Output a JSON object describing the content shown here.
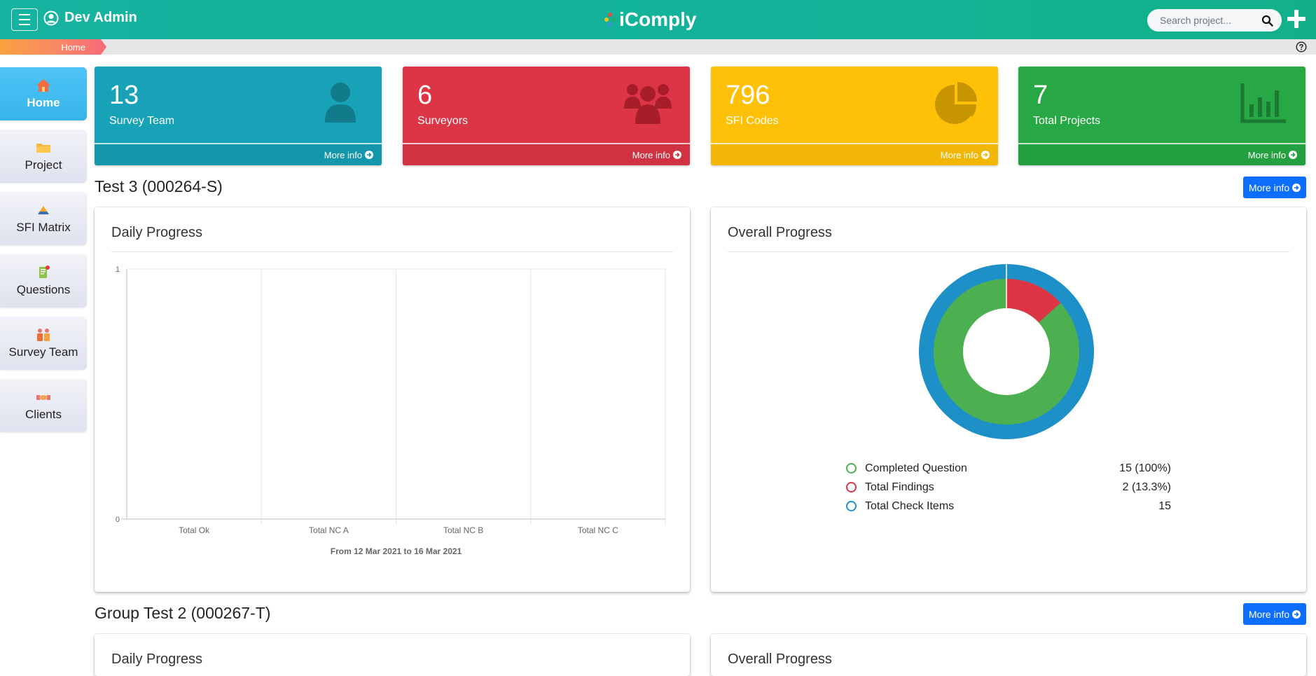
{
  "header": {
    "user_name": "Dev Admin",
    "brand": "iComply",
    "search_placeholder": "Search project..."
  },
  "breadcrumb": {
    "home": "Home"
  },
  "sidebar": {
    "items": [
      {
        "label": "Home",
        "icon": "house-icon"
      },
      {
        "label": "Project",
        "icon": "folder-icon"
      },
      {
        "label": "SFI Matrix",
        "icon": "pyramid-icon"
      },
      {
        "label": "Questions",
        "icon": "clipboard-icon"
      },
      {
        "label": "Survey Team",
        "icon": "team-icon"
      },
      {
        "label": "Clients",
        "icon": "handshake-icon"
      }
    ]
  },
  "stats": [
    {
      "value": "13",
      "label": "Survey Team",
      "more": "More info",
      "color": "#17a2b8",
      "icon": "user-icon"
    },
    {
      "value": "6",
      "label": "Surveyors",
      "more": "More info",
      "color": "#dc3545",
      "icon": "users-icon"
    },
    {
      "value": "796",
      "label": "SFI Codes",
      "more": "More info",
      "color": "#ffc107",
      "icon": "pie-chart-icon"
    },
    {
      "value": "7",
      "label": "Total Projects",
      "more": "More info",
      "color": "#28a745",
      "icon": "bar-chart-icon"
    }
  ],
  "projects": [
    {
      "title": "Test 3 (000264-S)",
      "more": "More info",
      "daily_title": "Daily Progress",
      "overall_title": "Overall Progress",
      "legend": [
        {
          "label": "Completed Question",
          "value": "15 (100%)",
          "color": "#4caf50"
        },
        {
          "label": "Total Findings",
          "value": "2 (13.3%)",
          "color": "#dc3545"
        },
        {
          "label": "Total Check Items",
          "value": "15",
          "color": "#1e90c8"
        }
      ]
    },
    {
      "title": "Group Test 2 (000267-T)",
      "more": "More info",
      "daily_title": "Daily Progress",
      "overall_title": "Overall Progress"
    }
  ],
  "chart_data": [
    {
      "type": "bar",
      "categories": [
        "Total Ok",
        "Total NC A",
        "Total NC B",
        "Total NC C"
      ],
      "values": [
        0,
        0,
        0,
        0
      ],
      "ylim": [
        0,
        1
      ],
      "yticks": [
        "0",
        "1"
      ],
      "xlabel": "From 12 Mar 2021 to 16 Mar 2021"
    },
    {
      "type": "pie",
      "inner_ring": {
        "completed": 15,
        "findings": 2,
        "colors": [
          "#4caf50",
          "#dc3545"
        ]
      },
      "outer_ring": {
        "check_items": 15,
        "color": "#1e90c8"
      }
    }
  ]
}
